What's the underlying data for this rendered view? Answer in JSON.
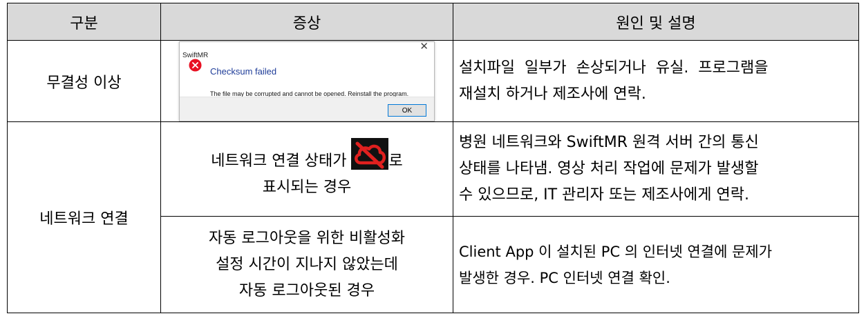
{
  "table": {
    "headers": [
      "구분",
      "증상",
      "원인 및 설명"
    ],
    "rows": {
      "integrity": {
        "category": "무결성 이상",
        "dialog": {
          "window_title": "SwiftMR",
          "close_glyph": "✕",
          "heading": "Checksum failed",
          "message": "The file may be corrupted and cannot be opened. Reinstall the program.",
          "ok_label": "OK",
          "icon": "error-circle-icon"
        },
        "cause_line1": "설치파일  일부가  손상되거나  유실.  프로그램을",
        "cause_line2": "재설치 하거나 제조사에 연락."
      },
      "network": {
        "category": "네트워크 연결",
        "symptom1_before_icon": "네트워크 연결 상태가 ",
        "symptom1_after_icon": "로",
        "symptom1_line2": "표시되는 경우",
        "symptom1_icon": "cloud-disconnected-icon",
        "cause1_line1": "병원 네트워크와 SwiftMR 원격 서버 간의 통신",
        "cause1_line2": "상태를 나타냄. 영상 처리 작업에 문제가 발생할",
        "cause1_line3": "수 있으므로, IT 관리자 또는 제조사에게 연락.",
        "symptom2_line1": "자동 로그아웃을 위한 비활성화",
        "symptom2_line2": "설정 시간이 지나지 않았는데",
        "symptom2_line3": "자동 로그아웃된 경우",
        "cause2_line1": "Client App 이 설치된 PC 의 인터넷 연결에 문제가",
        "cause2_line2": "발생한 경우. PC 인터넷 연결 확인."
      }
    }
  },
  "colors": {
    "header_bg": "#d9d9d9",
    "error_red": "#e81123",
    "cloud_bg": "#111111",
    "cloud_red": "#e0201f",
    "dialog_heading": "#1f3d99"
  }
}
